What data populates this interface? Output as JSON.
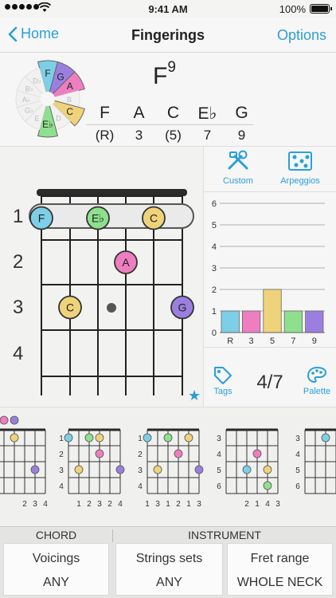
{
  "status": {
    "time": "9:41 AM",
    "battery": "100%"
  },
  "nav": {
    "back_label": "Home",
    "title": "Fingerings",
    "options_label": "Options"
  },
  "wheel": {
    "labels": [
      "F",
      "G",
      "A",
      "B",
      "C",
      "D",
      "E♭",
      "E",
      "G♭",
      "A♭",
      "B♭",
      "D♭"
    ],
    "highlighted": [
      "F",
      "G",
      "A",
      "C",
      "E♭"
    ]
  },
  "chord": {
    "root": "F",
    "extension": "9",
    "notes": [
      "F",
      "A",
      "C",
      "E♭",
      "G"
    ],
    "intervals": [
      "(R)",
      "3",
      "(5)",
      "7",
      "9"
    ]
  },
  "colors": {
    "F": "#7ccfe6",
    "G": "#9b7fe0",
    "A": "#ee7ec0",
    "C": "#efd37a",
    "Eb": "#8ee08e",
    "accent": "#2a9fd8"
  },
  "fretboard": {
    "fret_numbers": [
      "1",
      "2",
      "3",
      "4"
    ],
    "markers": [
      {
        "string": 1,
        "fret": 1,
        "note": "F",
        "color_key": "F"
      },
      {
        "string": 3,
        "fret": 1,
        "note": "E♭",
        "color_key": "Eb"
      },
      {
        "string": 5,
        "fret": 1,
        "note": "C",
        "color_key": "C"
      },
      {
        "string": 4,
        "fret": 2,
        "note": "A",
        "color_key": "A"
      },
      {
        "string": 2,
        "fret": 3,
        "note": "C",
        "color_key": "C"
      },
      {
        "string": 6,
        "fret": 3,
        "note": "G",
        "color_key": "G"
      }
    ]
  },
  "tools": {
    "custom_label": "Custom",
    "arpeggios_label": "Arpeggios",
    "tags_label": "Tags",
    "palette_label": "Palette",
    "count": "4/7"
  },
  "chart_data": {
    "type": "bar",
    "categories": [
      "R",
      "3",
      "5",
      "7",
      "9"
    ],
    "values": [
      1,
      1,
      2,
      1,
      1
    ],
    "colors": [
      "#7ccfe6",
      "#ee7ec0",
      "#efd37a",
      "#8ee08e",
      "#9b7fe0"
    ],
    "yticks": [
      "0",
      "1",
      "2",
      "3",
      "4",
      "5",
      "6"
    ],
    "ylim": [
      0,
      6
    ]
  },
  "voicings": [
    {
      "fingers": [
        "2",
        "3",
        "4"
      ]
    },
    {
      "fingers": [
        "1",
        "2",
        "3",
        "2",
        "4"
      ],
      "frets": [
        "1",
        "2",
        "3",
        "4"
      ]
    },
    {
      "fingers": [
        "1",
        "3",
        "1",
        "2",
        "1",
        "3"
      ],
      "frets": [
        "1",
        "2",
        "3",
        "4"
      ]
    },
    {
      "fingers": [
        "2",
        "1",
        "4",
        "3"
      ],
      "frets": [
        "3",
        "4",
        "5",
        "6"
      ]
    },
    {
      "frets": [
        "3",
        "4",
        "5",
        "6"
      ]
    }
  ],
  "settings": {
    "chord_section": "CHORD",
    "instrument_section": "INSTRUMENT",
    "voicings_label": "Voicings",
    "voicings_value": "ANY",
    "strings_label": "Strings sets",
    "strings_value": "ANY",
    "fret_label": "Fret range",
    "fret_value": "WHOLE NECK"
  }
}
